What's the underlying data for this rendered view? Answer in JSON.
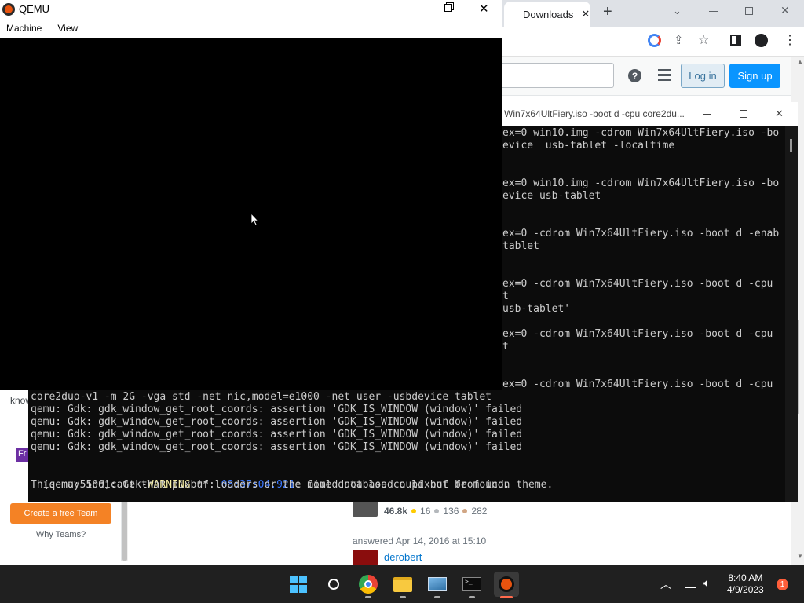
{
  "browser": {
    "tab_label": "Downloads",
    "new_tab": "+",
    "login_label": "Log in",
    "signup_label": "Sign up",
    "left_panel": {
      "partial_text": "know",
      "badge_text": "Fr",
      "cta_label": "Create a free Team",
      "why_label": "Why Teams?"
    },
    "answer": {
      "reputation": "46.8k",
      "gold": "16",
      "silver": "136",
      "bronze": "282",
      "answered": "answered Apr 14, 2016 at 15:10",
      "user": "derobert"
    }
  },
  "terminal": {
    "title": "Win7x64UltFiery.iso -boot d -cpu core2du...",
    "right_lines": [
      "ex=0 win10.img -cdrom Win7x64UltFiery.iso -bo",
      "evice  usb-tablet -localtime",
      "",
      "",
      "ex=0 win10.img -cdrom Win7x64UltFiery.iso -bo",
      "evice usb-tablet",
      "",
      "",
      "ex=0 -cdrom Win7x64UltFiery.iso -boot d -enab",
      "tablet",
      "",
      "",
      "ex=0 -cdrom Win7x64UltFiery.iso -boot d -cpu",
      "t",
      "usb-tablet'",
      "",
      "ex=0 -cdrom Win7x64UltFiery.iso -boot d -cpu",
      "t",
      "",
      "",
      "ex=0 -cdrom Win7x64UltFiery.iso -boot d -cpu"
    ],
    "bottom_lines": [
      "core2duo-v1 -m 2G -vga std -net nic,model=e1000 -net user -usbdevice tablet",
      "qemu: Gdk: gdk_window_get_root_coords: assertion 'GDK_IS_WINDOW (window)' failed",
      "qemu: Gdk: gdk_window_get_root_coords: assertion 'GDK_IS_WINDOW (window)' failed",
      "qemu: Gdk: gdk_window_get_root_coords: assertion 'GDK_IS_WINDOW (window)' failed",
      "qemu: Gdk: gdk_window_get_root_coords: assertion 'GDK_IS_WINDOW (window)' failed",
      ""
    ],
    "warning": {
      "prefix": "(qemu:5500): Gtk-",
      "level": "WARNING",
      "mid": " **: ",
      "time": "08:37:04.921",
      "msg": ": Could not load a pixbuf from icon theme."
    },
    "last_line": "This may indicate that pixbuf loaders or the mime database could not be found."
  },
  "qemu": {
    "title": "QEMU",
    "menu": [
      "Machine",
      "View"
    ]
  },
  "taskbar": {
    "time": "8:40 AM",
    "date": "4/9/2023",
    "notification_count": "1"
  },
  "colors": {
    "accent_orange": "#f48225",
    "signup_blue": "#0a95ff",
    "terminal_bg": "#0c0c0c",
    "warning_yellow": "#f9f1a5",
    "time_blue": "#3b78ff"
  }
}
